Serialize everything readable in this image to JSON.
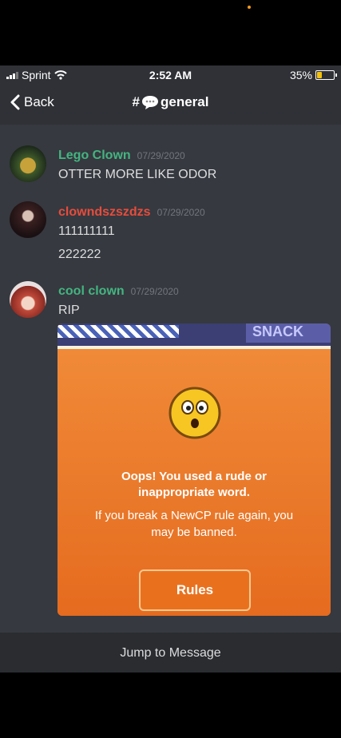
{
  "status": {
    "carrier": "Sprint",
    "time": "2:52 AM",
    "battery": "35%",
    "battery_level": 0.35
  },
  "nav": {
    "back_label": "Back",
    "channel_prefix": "#",
    "channel_name": "general"
  },
  "messages": [
    {
      "user": "Lego Clown",
      "user_color": "#43b581",
      "timestamp": "07/29/2020",
      "lines": [
        "OTTER MORE LIKE ODOR"
      ]
    },
    {
      "user": "clowndszszdzs",
      "user_color": "#e74c3c",
      "timestamp": "07/29/2020",
      "lines": [
        "111111111",
        "222222"
      ]
    },
    {
      "user": "cool clown",
      "user_color": "#43b581",
      "timestamp": "07/29/2020",
      "lines": [
        "RIP"
      ]
    }
  ],
  "embed": {
    "snack_text": "SNACK",
    "title_line1": "Oops! You used a rude or",
    "title_line2": "inappropriate word.",
    "body_line1": "If you break a NewCP rule again, you",
    "body_line2": "may be banned.",
    "button_label": "Rules"
  },
  "footer": {
    "jump_label": "Jump to Message"
  },
  "colors": {
    "background": "#36393f",
    "modal_orange": "#e8702a"
  }
}
